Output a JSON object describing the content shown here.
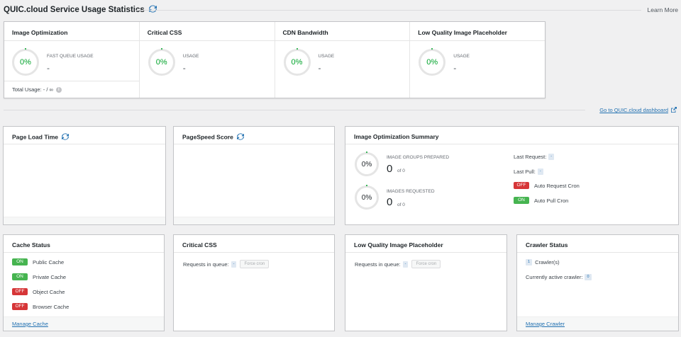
{
  "header": {
    "title": "QUIC.cloud Service Usage Statistics",
    "learn_more": "Learn More",
    "dashboard_link": "Go to QUIC.cloud dashboard"
  },
  "usage": [
    {
      "title": "Image Optimization",
      "percent": "0%",
      "label": "FAST QUEUE USAGE",
      "value": "-"
    },
    {
      "title": "Critical CSS",
      "percent": "0%",
      "label": "USAGE",
      "value": "-"
    },
    {
      "title": "CDN Bandwidth",
      "percent": "0%",
      "label": "USAGE",
      "value": "-"
    },
    {
      "title": "Low Quality Image Placeholder",
      "percent": "0%",
      "label": "USAGE",
      "value": "-"
    }
  ],
  "total_usage": "Total Usage: - / ∞",
  "page_load": {
    "title": "Page Load Time"
  },
  "pagespeed": {
    "title": "PageSpeed Score"
  },
  "img_summary": {
    "title": "Image Optimization Summary",
    "groups_label": "IMAGE GROUPS PREPARED",
    "groups_percent": "0%",
    "groups_value": "0",
    "groups_of": "of 0",
    "requested_label": "IMAGES REQUESTED",
    "requested_percent": "0%",
    "requested_value": "0",
    "requested_of": "of 0",
    "last_request_label": "Last Request:",
    "last_request_value": "-",
    "last_pull_label": "Last Pull:",
    "last_pull_value": "-",
    "auto_request_state": "OFF",
    "auto_request_label": "Auto Request Cron",
    "auto_pull_state": "ON",
    "auto_pull_label": "Auto Pull Cron"
  },
  "cache_status": {
    "title": "Cache Status",
    "items": [
      {
        "state": "ON",
        "label": "Public Cache"
      },
      {
        "state": "ON",
        "label": "Private Cache"
      },
      {
        "state": "OFF",
        "label": "Object Cache"
      },
      {
        "state": "OFF",
        "label": "Browser Cache"
      }
    ],
    "link": "Manage Cache"
  },
  "critical_css": {
    "title": "Critical CSS",
    "queue_label": "Requests in queue:",
    "queue_value": "-",
    "button": "Force cron"
  },
  "lqip": {
    "title": "Low Quality Image Placeholder",
    "queue_label": "Requests in queue:",
    "queue_value": "-",
    "button": "Force cron"
  },
  "crawler": {
    "title": "Crawler Status",
    "count": "1",
    "count_label": "Crawler(s)",
    "active_label": "Currently active crawler:",
    "active_value": "0",
    "link": "Manage Crawler"
  },
  "colors": {
    "on": "#46b450",
    "off": "#d63638",
    "link": "#2271b1",
    "ring_text": "#00a32a"
  }
}
